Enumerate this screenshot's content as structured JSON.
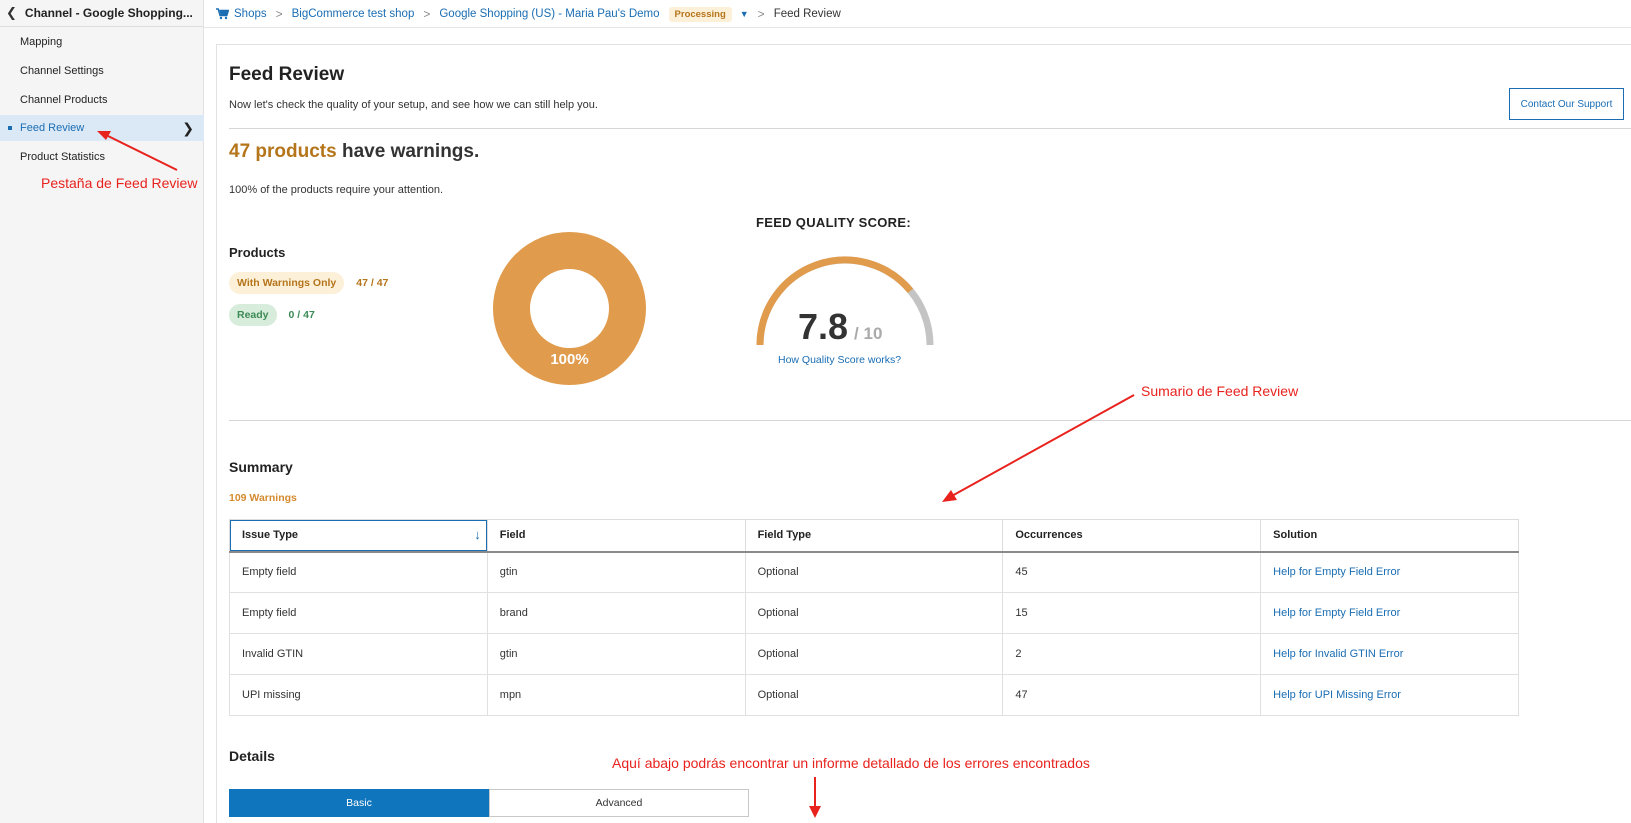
{
  "sidebar": {
    "header": "Channel - Google Shopping...",
    "items": [
      {
        "label": "Mapping"
      },
      {
        "label": "Channel Settings"
      },
      {
        "label": "Channel Products"
      },
      {
        "label": "Feed Review"
      },
      {
        "label": "Product Statistics"
      }
    ]
  },
  "breadcrumb": {
    "items": [
      "Shops",
      "BigCommerce test shop",
      "Google Shopping (US) - Maria Pau's Demo"
    ],
    "status_badge": "Processing",
    "current": "Feed Review"
  },
  "page": {
    "title": "Feed Review",
    "subtitle": "Now let's check the quality of your setup, and see how we can still help you.",
    "contact_button": "Contact Our Support"
  },
  "warnings": {
    "count_text": "47 products",
    "rest_text": "have warnings.",
    "attention_text": "100% of the products require your attention."
  },
  "products": {
    "label": "Products",
    "with_warnings_label": "With Warnings Only",
    "with_warnings_count": "47 / 47",
    "ready_label": "Ready",
    "ready_count": "0 / 47",
    "donut_label": "100%"
  },
  "chart_data": {
    "type": "pie",
    "categories": [
      "With Warnings Only",
      "Ready"
    ],
    "values": [
      47,
      0
    ],
    "center_label": "100%"
  },
  "quality": {
    "label": "FEED QUALITY SCORE:",
    "score": "7.8",
    "max": "/ 10",
    "score_value": 7.8,
    "score_max": 10,
    "link": "How Quality Score works?"
  },
  "summary": {
    "title": "Summary",
    "count": "109 Warnings",
    "columns": [
      "Issue Type",
      "Field",
      "Field Type",
      "Occurrences",
      "Solution"
    ],
    "rows": [
      [
        "Empty field",
        "gtin",
        "Optional",
        "45",
        "Help for Empty Field Error"
      ],
      [
        "Empty field",
        "brand",
        "Optional",
        "15",
        "Help for Empty Field Error"
      ],
      [
        "Invalid GTIN",
        "gtin",
        "Optional",
        "2",
        "Help for Invalid GTIN Error"
      ],
      [
        "UPI missing",
        "mpn",
        "Optional",
        "47",
        "Help for UPI Missing Error"
      ]
    ]
  },
  "details": {
    "title": "Details",
    "tab_basic": "Basic",
    "tab_advanced": "Advanced"
  },
  "annotations": {
    "feed_review_tab": "Pestaña de Feed Review",
    "summary_note": "Sumario de Feed Review",
    "details_note": "Aquí abajo podrás encontrar un informe detallado de los errores encontrados"
  },
  "colors": {
    "accent_orange": "#b5751b",
    "donut_orange": "#e09b4c",
    "link_blue": "#1a6db3",
    "annotation_red": "#e8231e"
  }
}
